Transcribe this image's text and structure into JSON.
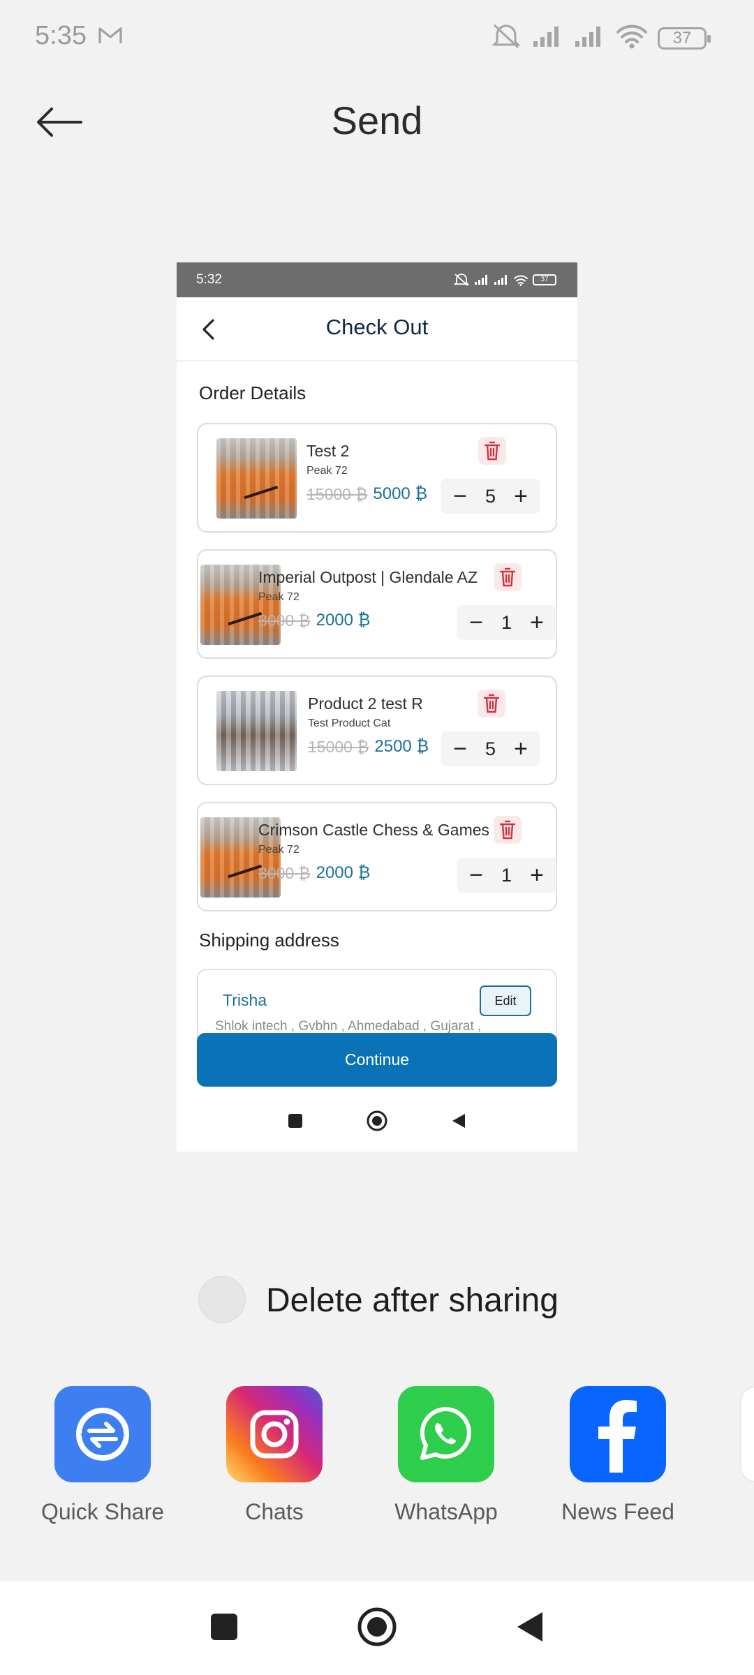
{
  "status_bar": {
    "time": "5:35",
    "battery": "37"
  },
  "header": {
    "title": "Send"
  },
  "preview": {
    "status_bar": {
      "time": "5:32",
      "battery": "37"
    },
    "title": "Check Out",
    "order_section": "Order Details",
    "items": [
      {
        "name": "Test 2",
        "category": "Peak 72",
        "old_price": "15000 ₿",
        "new_price": "5000 ₿",
        "qty": "5"
      },
      {
        "name": "Imperial Outpost | Glendale AZ",
        "category": "Peak 72",
        "old_price": "3000 ₿",
        "new_price": "2000 ₿",
        "qty": "1"
      },
      {
        "name": "Product 2 test R",
        "category": "Test Product Cat",
        "old_price": "15000 ₿",
        "new_price": "2500 ₿",
        "qty": "5"
      },
      {
        "name": "Crimson Castle Chess & Games",
        "category": "Peak 72",
        "old_price": "3000 ₿",
        "new_price": "2000 ₿",
        "qty": "1"
      }
    ],
    "stepper": {
      "minus": "−",
      "plus": "+"
    },
    "shipping_section": "Shipping address",
    "address": {
      "name": "Trisha",
      "edit_label": "Edit",
      "line": "Shlok intech ,  Gvbhn ,  Ahmedabad ,  Gujarat ,"
    },
    "continue_label": "Continue"
  },
  "delete_after_sharing": {
    "label": "Delete after sharing",
    "checked": false
  },
  "share_targets": [
    {
      "label": "Quick Share",
      "icon": "quick-share-icon",
      "color": "#3d7ef0"
    },
    {
      "label": "Chats",
      "icon": "instagram-icon",
      "color": "#e1306c"
    },
    {
      "label": "WhatsApp",
      "icon": "whatsapp-icon",
      "color": "#2fcd4c"
    },
    {
      "label": "News Feed",
      "icon": "facebook-icon",
      "color": "#0866ff"
    }
  ],
  "colors": {
    "accent": "#0a73b7",
    "price": "#1b6f98",
    "title": "#0f2a44",
    "trash": "#d6303f"
  }
}
